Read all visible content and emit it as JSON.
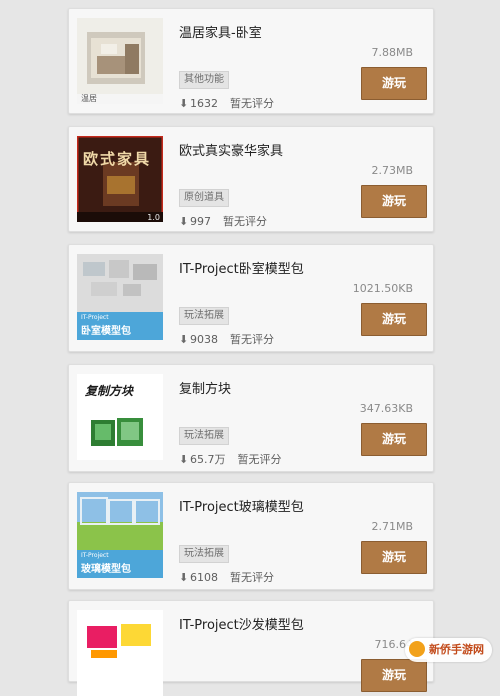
{
  "items": [
    {
      "title": "温居家具-卧室",
      "size": "7.88MB",
      "tag": "其他功能",
      "downloads": "1632",
      "rating": "暂无评分",
      "button": "游玩",
      "thumb_caption": "温居"
    },
    {
      "title": "欧式真实豪华家具",
      "size": "2.73MB",
      "tag": "原创道具",
      "downloads": "997",
      "rating": "暂无评分",
      "button": "游玩",
      "thumb_caption": "欧式家具",
      "thumb_version": "1.0"
    },
    {
      "title": "IT-Project卧室模型包",
      "size": "1021.50KB",
      "tag": "玩法拓展",
      "downloads": "9038",
      "rating": "暂无评分",
      "button": "游玩",
      "thumb_caption": "卧室模型包",
      "thumb_sub": "IT-Project"
    },
    {
      "title": "复制方块",
      "size": "347.63KB",
      "tag": "玩法拓展",
      "downloads": "65.7万",
      "rating": "暂无评分",
      "button": "游玩",
      "thumb_caption": "复制方块"
    },
    {
      "title": "IT-Project玻璃模型包",
      "size": "2.71MB",
      "tag": "玩法拓展",
      "downloads": "6108",
      "rating": "暂无评分",
      "button": "游玩",
      "thumb_caption": "玻璃模型包",
      "thumb_sub": "IT-Project"
    },
    {
      "title": "IT-Project沙发模型包",
      "size": "716.64",
      "tag": "",
      "downloads": "",
      "rating": "",
      "button": "游玩"
    }
  ],
  "watermark": "新侨手游网",
  "colors": {
    "play_button": "#b07a45",
    "background": "#e6e6e6",
    "card": "#f7f7f7"
  }
}
